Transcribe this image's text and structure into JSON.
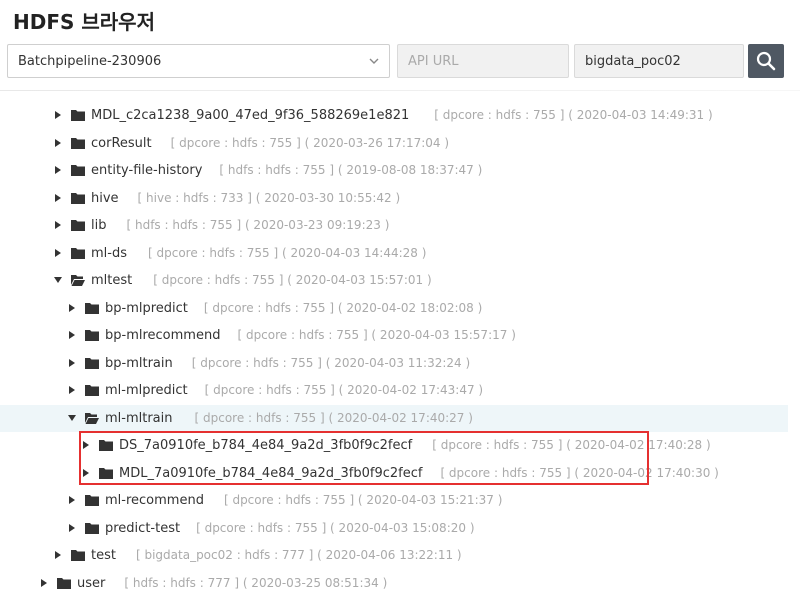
{
  "header": {
    "title": "HDFS 브라우저",
    "pipeline_select": "Batchpipeline-230906",
    "api_url_placeholder": "API URL",
    "user_value": "bigdata_poc02"
  },
  "tree": [
    {
      "name": "MDL_c2ca1238_9a00_47ed_9f36_588269e1e821",
      "meta": "[ dpcore : hdfs : 755 ] ( 2020-04-03 14:49:31 )",
      "expanded": false
    },
    {
      "name": "corResult",
      "meta": "[ dpcore : hdfs : 755 ] ( 2020-03-26 17:17:04 )",
      "expanded": false
    },
    {
      "name": "entity-file-history",
      "meta": "[ hdfs : hdfs : 755 ] ( 2019-08-08 18:37:47 )",
      "expanded": false
    },
    {
      "name": "hive",
      "meta": "[ hive : hdfs : 733 ] ( 2020-03-30 10:55:42 )",
      "expanded": false
    },
    {
      "name": "lib",
      "meta": "[ hdfs : hdfs : 755 ] ( 2020-03-23 09:19:23 )",
      "expanded": false
    },
    {
      "name": "ml-ds",
      "meta": "[ dpcore : hdfs : 755 ] ( 2020-04-03 14:44:28 )",
      "expanded": false
    },
    {
      "name": "mltest",
      "meta": "[ dpcore : hdfs : 755 ] ( 2020-04-03 15:57:01 )",
      "expanded": true
    },
    {
      "name": "bp-mlpredict",
      "meta": "[ dpcore : hdfs : 755 ] ( 2020-04-02 18:02:08 )",
      "expanded": false
    },
    {
      "name": "bp-mlrecommend",
      "meta": "[ dpcore : hdfs : 755 ] ( 2020-04-03 15:57:17 )",
      "expanded": false
    },
    {
      "name": "bp-mltrain",
      "meta": "[ dpcore : hdfs : 755 ] ( 2020-04-03 11:32:24 )",
      "expanded": false
    },
    {
      "name": "ml-mlpredict",
      "meta": "[ dpcore : hdfs : 755 ] ( 2020-04-02 17:43:47 )",
      "expanded": false
    },
    {
      "name": "ml-mltrain",
      "meta": "[ dpcore : hdfs : 755 ] ( 2020-04-02 17:40:27 )",
      "expanded": true,
      "selected": true
    },
    {
      "name": "DS_7a0910fe_b784_4e84_9a2d_3fb0f9c2fecf",
      "meta": "[ dpcore : hdfs : 755 ] ( 2020-04-02 17:40:28 )",
      "expanded": false
    },
    {
      "name": "MDL_7a0910fe_b784_4e84_9a2d_3fb0f9c2fecf",
      "meta": "[ dpcore : hdfs : 755 ] ( 2020-04-02 17:40:30 )",
      "expanded": false
    },
    {
      "name": "ml-recommend",
      "meta": "[ dpcore : hdfs : 755 ] ( 2020-04-03 15:21:37 )",
      "expanded": false
    },
    {
      "name": "predict-test",
      "meta": "[ dpcore : hdfs : 755 ] ( 2020-04-03 15:08:20 )",
      "expanded": false
    },
    {
      "name": "test",
      "meta": "[ bigdata_poc02 : hdfs : 777 ] ( 2020-04-06 13:22:11 )",
      "expanded": false
    },
    {
      "name": "user",
      "meta": "[ hdfs : hdfs : 777 ] ( 2020-03-25 08:51:34 )",
      "expanded": false
    }
  ],
  "colors": {
    "accent_button": "#4f5863",
    "highlight_row": "#eef6f9",
    "annotation_box": "#e53030"
  }
}
